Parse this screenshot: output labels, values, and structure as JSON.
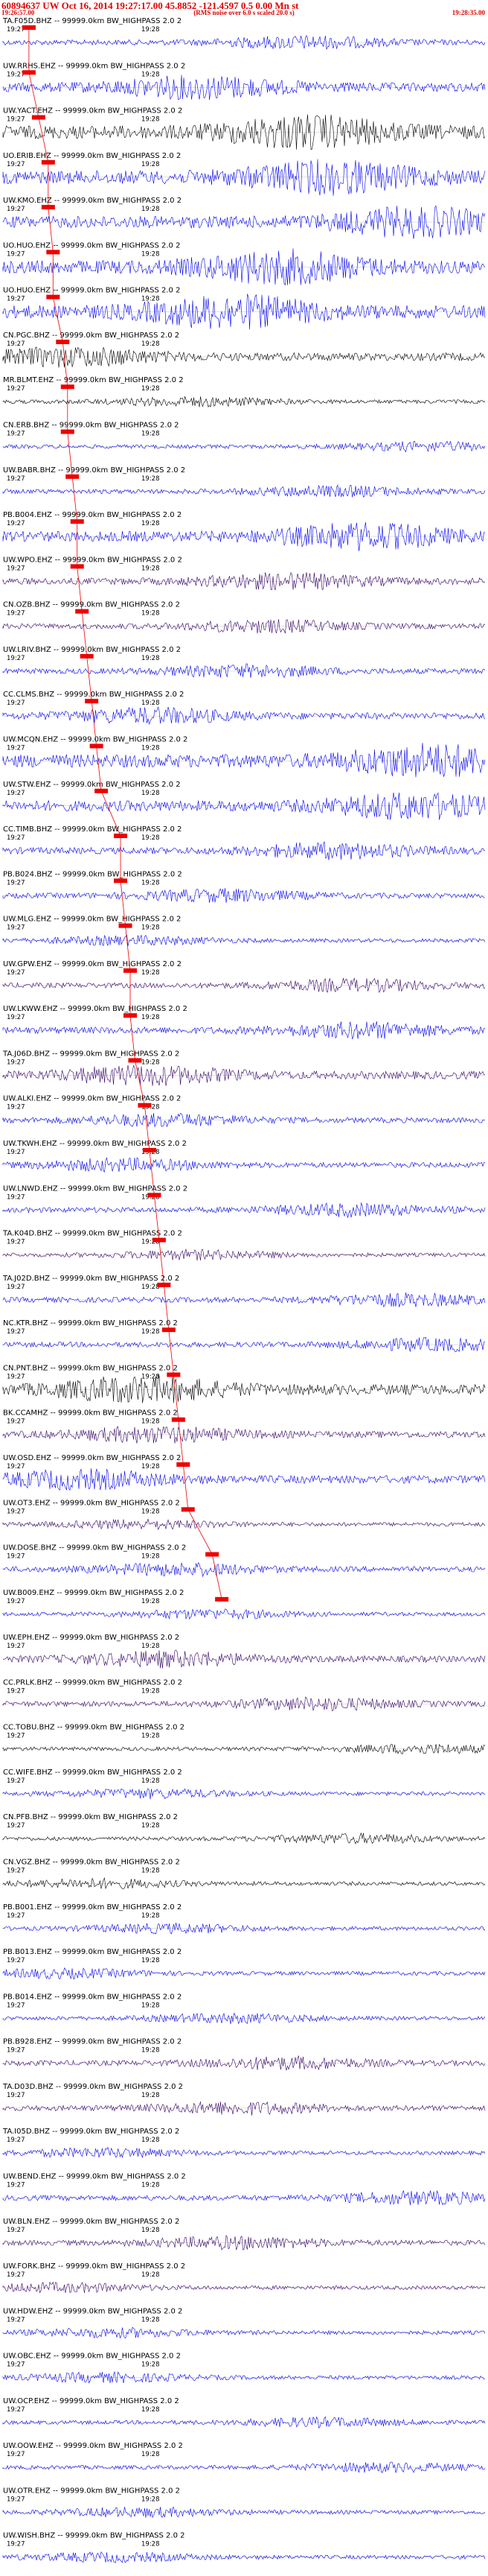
{
  "header": {
    "title": "60894637 UW Oct 16, 2014 19:27:17.00   45.8852 -121.4597  0.5 0.00 Mn st",
    "subtitle": "(RMS noise over 6.0 s scaled 20.0 s)",
    "start_time": "19:26:57.00",
    "end_time": "19:28:35.00"
  },
  "colors": {
    "pick": "#ee0000",
    "blue": "#0000ee",
    "purple": "#330066",
    "black": "#000000"
  },
  "chart_data": {
    "type": "line",
    "title": "60894637 UW Oct 16, 2014 19:27:17.00   45.8852 -121.4597  0.5 0.00 Mn st",
    "time_ticks": [
      "19:27",
      "19:28"
    ],
    "traces": [
      {
        "label": "TA.F05D.BHZ -- 99999.0km BW_HIGHPASS  2.0  2",
        "color": "blue",
        "amp": 0.4,
        "pick": 0.04
      },
      {
        "label": "UW.RRHS.EHZ -- 99999.0km BW_HIGHPASS  2.0  2",
        "color": "blue",
        "amp": 0.7,
        "pick": 0.04
      },
      {
        "label": "UW.YACT.EHZ -- 99999.0km BW_HIGHPASS  2.0  2",
        "color": "black",
        "amp": 1.0,
        "pick": 0.06
      },
      {
        "label": "UO.ERIB.EHZ -- 99999.0km BW_HIGHPASS  2.0  2",
        "color": "blue",
        "amp": 1.0,
        "pick": 0.08
      },
      {
        "label": "UW.KMO.EHZ -- 99999.0km BW_HIGHPASS  2.0  2",
        "color": "blue",
        "amp": 0.9,
        "pick": 0.08
      },
      {
        "label": "UO.HUO.EHZ -- 99999.0km BW_HIGHPASS  2.0  2",
        "color": "blue",
        "amp": 1.0,
        "pick": 0.09
      },
      {
        "label": "UO.HUO.EHZ -- 99999.0km BW_HIGHPASS  2.0  2",
        "color": "blue",
        "amp": 1.0,
        "pick": 0.09
      },
      {
        "label": "CN.PGC.BHZ -- 99999.0km BW_HIGHPASS  2.0  2",
        "color": "black",
        "amp": 0.6,
        "pick": 0.11
      },
      {
        "label": "MR.BLMT.EHZ -- 99999.0km BW_HIGHPASS  2.0  2",
        "color": "black",
        "amp": 0.3,
        "pick": 0.12
      },
      {
        "label": "CN.ERB.BHZ -- 99999.0km BW_HIGHPASS  2.0  2",
        "color": "blue",
        "amp": 0.3,
        "pick": 0.12
      },
      {
        "label": "UW.BABR.BHZ -- 99999.0km BW_HIGHPASS  2.0  2",
        "color": "blue",
        "amp": 0.35,
        "pick": 0.13
      },
      {
        "label": "PB.B004.EHZ -- 99999.0km BW_HIGHPASS  2.0  2",
        "color": "blue",
        "amp": 0.8,
        "pick": 0.14
      },
      {
        "label": "UW.WPO.EHZ -- 99999.0km BW_HIGHPASS  2.0  2",
        "color": "purple",
        "amp": 0.5,
        "pick": 0.14
      },
      {
        "label": "CN.OZB.BHZ -- 99999.0km BW_HIGHPASS  2.0  2",
        "color": "purple",
        "amp": 0.4,
        "pick": 0.15
      },
      {
        "label": "UW.LRIV.BHZ -- 99999.0km BW_HIGHPASS  2.0  2",
        "color": "blue",
        "amp": 0.4,
        "pick": 0.16
      },
      {
        "label": "CC.CLMS.BHZ -- 99999.0km BW_HIGHPASS  2.0  2",
        "color": "blue",
        "amp": 0.5,
        "pick": 0.17
      },
      {
        "label": "UW.MCQN.EHZ -- 99999.0km BW_HIGHPASS  2.0  2",
        "color": "blue",
        "amp": 1.0,
        "pick": 0.18
      },
      {
        "label": "UW.STW.EHZ -- 99999.0km BW_HIGHPASS  2.0  2",
        "color": "blue",
        "amp": 0.8,
        "pick": 0.19
      },
      {
        "label": "CC.TIMB.BHZ -- 99999.0km BW_HIGHPASS  2.0  2",
        "color": "blue",
        "amp": 0.5,
        "pick": 0.23
      },
      {
        "label": "PB.B024.BHZ -- 99999.0km BW_HIGHPASS  2.0  2",
        "color": "blue",
        "amp": 0.4,
        "pick": 0.23
      },
      {
        "label": "UW.MLG.EHZ -- 99999.0km BW_HIGHPASS  2.0  2",
        "color": "blue",
        "amp": 0.3,
        "pick": 0.24
      },
      {
        "label": "UW.GPW.EHZ -- 99999.0km BW_HIGHPASS  2.0  2",
        "color": "purple",
        "amp": 0.4,
        "pick": 0.25
      },
      {
        "label": "UW.LKWW.EHZ -- 99999.0km BW_HIGHPASS  2.0  2",
        "color": "blue",
        "amp": 0.5,
        "pick": 0.25
      },
      {
        "label": "TA.J06D.BHZ -- 99999.0km BW_HIGHPASS  2.0  2",
        "color": "purple",
        "amp": 0.6,
        "pick": 0.26
      },
      {
        "label": "UW.ALKI.EHZ -- 99999.0km BW_HIGHPASS  2.0  2",
        "color": "blue",
        "amp": 0.4,
        "pick": 0.28
      },
      {
        "label": "UW.TKWH.EHZ -- 99999.0km BW_HIGHPASS  2.0  2",
        "color": "blue",
        "amp": 0.4,
        "pick": 0.29
      },
      {
        "label": "UW.LNWD.EHZ -- 99999.0km BW_HIGHPASS  2.0  2",
        "color": "blue",
        "amp": 0.4,
        "pick": 0.3
      },
      {
        "label": "TA.K04D.BHZ -- 99999.0km BW_HIGHPASS  2.0  2",
        "color": "purple",
        "amp": 0.3,
        "pick": 0.31
      },
      {
        "label": "TA.J02D.BHZ -- 99999.0km BW_HIGHPASS  2.0  2",
        "color": "blue",
        "amp": 0.4,
        "pick": 0.32
      },
      {
        "label": "NC.KTR.BHZ -- 99999.0km BW_HIGHPASS  2.0  2",
        "color": "blue",
        "amp": 0.4,
        "pick": 0.33
      },
      {
        "label": "CN.PNT.BHZ -- 99999.0km BW_HIGHPASS  2.0  2",
        "color": "black",
        "amp": 0.8,
        "pick": 0.34
      },
      {
        "label": "BK.CCAMHZ -- 99999.0km BW_HIGHPASS  2.0  2",
        "color": "purple",
        "amp": 0.5,
        "pick": 0.35
      },
      {
        "label": "UW.OSD.EHZ -- 99999.0km BW_HIGHPASS  2.0  2",
        "color": "blue",
        "amp": 0.6,
        "pick": 0.36
      },
      {
        "label": "UW.OT3.EHZ -- 99999.0km BW_HIGHPASS  2.0  2",
        "color": "purple",
        "amp": 0.3,
        "pick": 0.37
      },
      {
        "label": "UW.DOSE.BHZ -- 99999.0km BW_HIGHPASS  2.0  2",
        "color": "blue",
        "amp": 0.4,
        "pick": 0.42
      },
      {
        "label": "UW.B009.EHZ -- 99999.0km BW_HIGHPASS  2.0  2",
        "color": "blue",
        "amp": 0.3,
        "pick": 0.44
      },
      {
        "label": "UW.EPH.EHZ -- 99999.0km BW_HIGHPASS  2.0  2",
        "color": "purple",
        "amp": 0.5,
        "pick": null
      },
      {
        "label": "CC.PRLK.BHZ -- 99999.0km BW_HIGHPASS  2.0  2",
        "color": "purple",
        "amp": 0.4,
        "pick": null
      },
      {
        "label": "CC.TOBU.BHZ -- 99999.0km BW_HIGHPASS  2.0  2",
        "color": "black",
        "amp": 0.3,
        "pick": null
      },
      {
        "label": "CC.WIFE.BHZ -- 99999.0km BW_HIGHPASS  2.0  2",
        "color": "blue",
        "amp": 0.3,
        "pick": null
      },
      {
        "label": "CN.PFB.BHZ -- 99999.0km BW_HIGHPASS  2.0  2",
        "color": "black",
        "amp": 0.3,
        "pick": null
      },
      {
        "label": "CN.VGZ.BHZ -- 99999.0km BW_HIGHPASS  2.0  2",
        "color": "black",
        "amp": 0.3,
        "pick": null
      },
      {
        "label": "PB.B001.EHZ -- 99999.0km BW_HIGHPASS  2.0  2",
        "color": "blue",
        "amp": 0.3,
        "pick": null
      },
      {
        "label": "PB.B013.EHZ -- 99999.0km BW_HIGHPASS  2.0  2",
        "color": "blue",
        "amp": 0.3,
        "pick": null
      },
      {
        "label": "PB.B014.EHZ -- 99999.0km BW_HIGHPASS  2.0  2",
        "color": "blue",
        "amp": 0.3,
        "pick": null
      },
      {
        "label": "PB.B928.EHZ -- 99999.0km BW_HIGHPASS  2.0  2",
        "color": "purple",
        "amp": 0.4,
        "pick": null
      },
      {
        "label": "TA.D03D.BHZ -- 99999.0km BW_HIGHPASS  2.0  2",
        "color": "purple",
        "amp": 0.4,
        "pick": null
      },
      {
        "label": "TA.I05D.BHZ -- 99999.0km BW_HIGHPASS  2.0  2",
        "color": "blue",
        "amp": 0.3,
        "pick": null
      },
      {
        "label": "UW.BEND.EHZ -- 99999.0km BW_HIGHPASS  2.0  2",
        "color": "blue",
        "amp": 0.4,
        "pick": null
      },
      {
        "label": "UW.BLN.EHZ -- 99999.0km BW_HIGHPASS  2.0  2",
        "color": "purple",
        "amp": 0.4,
        "pick": null
      },
      {
        "label": "UW.FORK.BHZ -- 99999.0km BW_HIGHPASS  2.0  2",
        "color": "purple",
        "amp": 0.3,
        "pick": null
      },
      {
        "label": "UW.HDW.EHZ -- 99999.0km BW_HIGHPASS  2.0  2",
        "color": "blue",
        "amp": 0.3,
        "pick": null
      },
      {
        "label": "UW.OBC.EHZ -- 99999.0km BW_HIGHPASS  2.0  2",
        "color": "blue",
        "amp": 0.3,
        "pick": null
      },
      {
        "label": "UW.OCP.EHZ -- 99999.0km BW_HIGHPASS  2.0  2",
        "color": "blue",
        "amp": 0.3,
        "pick": null
      },
      {
        "label": "UW.OOW.EHZ -- 99999.0km BW_HIGHPASS  2.0  2",
        "color": "blue",
        "amp": 0.3,
        "pick": null
      },
      {
        "label": "UW.OTR.EHZ -- 99999.0km BW_HIGHPASS  2.0  2",
        "color": "blue",
        "amp": 0.3,
        "pick": null
      },
      {
        "label": "UW.WISH.BHZ -- 99999.0km BW_HIGHPASS  2.0  2",
        "color": "blue",
        "amp": 0.3,
        "pick": null
      }
    ]
  }
}
